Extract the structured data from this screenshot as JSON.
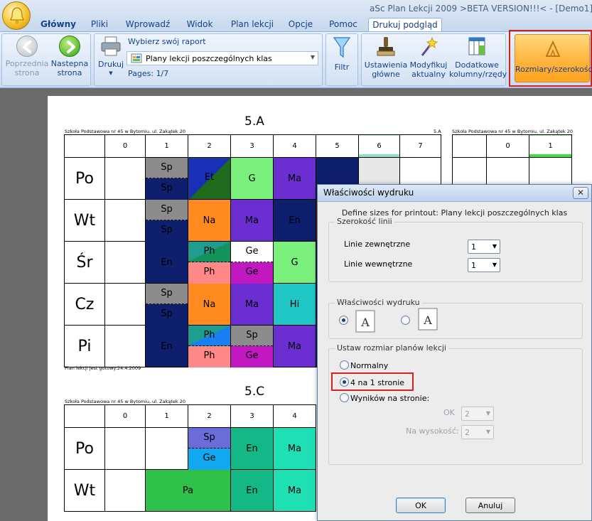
{
  "window": {
    "title": "aSc Plan Lekcji 2009  >BETA VERSION!!!< - [Demo1]"
  },
  "tabs": [
    "Główny",
    "Pliki",
    "Wprowadź",
    "Widok",
    "Plan lekcji",
    "Opcje",
    "Pomoc",
    "Drukuj podgląd"
  ],
  "ribbon": {
    "prev_label": "Poprzednia strona",
    "prev_l1": "Poprzednia",
    "prev_l2": "strona",
    "next_l1": "Nastepna",
    "next_l2": "strona",
    "print_label": "Drukuj",
    "report_caption": "Wybierz swój raport",
    "report_value": "Plany lekcji poszczególnych klas",
    "pages": "Pages: 1/7",
    "filter_label": "Filtr",
    "settings_l1": "Ustawienia",
    "settings_l2": "główne",
    "modify_l1": "Modyfikuj",
    "modify_l2": "aktualny",
    "extra_l1": "Dodatkowe",
    "extra_l2": "kolumny/rzędy",
    "sizes_label": "Rozmiary/szerokości"
  },
  "doc": {
    "class_a": "5.A",
    "class_c": "5.C",
    "school": "Szkoła Podstawowa nr 45 w Bytomiu,  ul. Zakątek 20",
    "school_right_tag": "5.A",
    "valid_note": "Plan lekcji jest gotowy:24.4.2009",
    "periods": [
      "0",
      "1",
      "2",
      "3",
      "4",
      "5",
      "6",
      "7"
    ],
    "days": [
      "Po",
      "Wt",
      "Śr",
      "Cz",
      "Pi"
    ],
    "subjects": {
      "sp": "Sp",
      "et": "Et",
      "g": "G",
      "ma": "Ma",
      "na": "Na",
      "en": "En",
      "ph": "Ph",
      "ge": "Ge",
      "hi": "Hi",
      "pa": "Pa"
    }
  },
  "dialog": {
    "title": "Właściwości wydruku",
    "close": "✕",
    "subtitle": "Define sizes for printout: Plany lekcji poszczególnych klas",
    "line_width_group": "Szerokość linii",
    "outer_lines": "Linie zewnętrzne",
    "inner_lines": "Linie wewnętrzne",
    "outer_value": "1",
    "inner_value": "1",
    "print_props_group": "Właściwości wydruku",
    "size_group": "Ustaw rozmiar planów lekcji",
    "opt_normal": "Normalny",
    "opt_four": "4 na 1 stronie",
    "opt_results": "Wyników na stronie:",
    "ok_label": "OK",
    "ok_value": "2",
    "height_label": "Na wysokość:",
    "height_value": "2",
    "ok_button": "OK",
    "cancel_button": "Anuluj"
  },
  "colors": {
    "accent": "#15428b",
    "highlight": "#d8201b",
    "ribbon_active": "#ffb239"
  }
}
